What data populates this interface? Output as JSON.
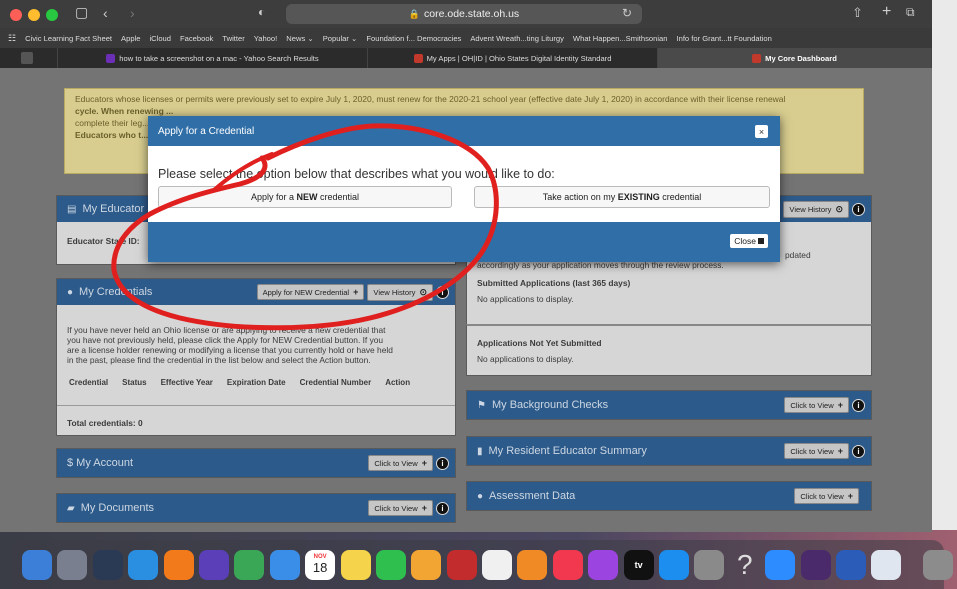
{
  "browser": {
    "url": "core.ode.state.oh.us",
    "bookmarks": [
      "Civic Learning Fact Sheet",
      "Apple",
      "iCloud",
      "Facebook",
      "Twitter",
      "Yahoo!",
      "News ⌄",
      "Popular ⌄",
      "Foundation f... Democracies",
      "Advent Wreath...ting Liturgy",
      "What Happen...Smithsonian",
      "Info for Grant...tt Foundation"
    ],
    "tabs": [
      {
        "label": "how to take a screenshot on a mac - Yahoo Search Results",
        "color": "#6b2fb6"
      },
      {
        "label": "My Apps | OH|ID | Ohio States Digital Identity Standard",
        "color": "#c0392b"
      },
      {
        "label": "My Core Dashboard",
        "color": "#c0392b",
        "active": true
      }
    ]
  },
  "page": {
    "warning_line1": "Educators whose licenses or permits were previously set to expire July 1, 2020, must renew for the 2020-21 school year (effective date July 1, 2020) in accordance with their license renewal",
    "warning_line2": "cycle. When renewing ...",
    "warning_line3": "complete their leg...",
    "warning_line4": "Educators who t...",
    "educator_panel": {
      "title": "My Educator",
      "sid_label": "Educator State ID:"
    },
    "view_history_label": "View History",
    "updated_text": "pdated",
    "review_text": "accordingly as your application moves through the review process.",
    "submitted_title": "Submitted Applications (last 365 days)",
    "submitted_empty": "No applications to display.",
    "notsubmitted_title": "Applications Not Yet Submitted",
    "notsubmitted_empty": "No applications to display.",
    "credentials": {
      "title": "My Credentials",
      "apply_btn": "Apply for NEW Credential",
      "history_btn": "View History",
      "help_line1": "If you have never held an Ohio license or are applying to receive a new credential that",
      "help_line2": "you have not previously held, please click the Apply for NEW Credential button. If you",
      "help_line3": "are a license holder renewing or modifying a license that you currently hold or have held",
      "help_line4": "in the past, please find the credential in the list below and select the Action button.",
      "columns": [
        "Credential",
        "Status",
        "Effective Year",
        "Expiration Date",
        "Credential Number",
        "Action"
      ],
      "total": "Total credentials: 0"
    },
    "account_title": "$ My Account",
    "documents_title": "My Documents",
    "background_title": "My Background Checks",
    "resident_title": "My Resident Educator Summary",
    "assessment_title": "Assessment Data",
    "click_to_view": "Click to View"
  },
  "modal": {
    "title": "Apply for a Credential",
    "close_x": "×",
    "prompt": "Please select the option below that describes what you would like to do:",
    "btn_new_prefix": "Apply for a ",
    "btn_new_bold": "NEW",
    "btn_new_suffix": " credential",
    "btn_existing_prefix": "Take action on my ",
    "btn_existing_bold": "EXISTING",
    "btn_existing_suffix": " credential",
    "close_label": "Close"
  },
  "dock": {
    "apps": [
      "finder-icon",
      "launchpad-icon",
      "mission-control-icon",
      "safari-icon",
      "firefox-icon",
      "notability-icon",
      "chrome-icon",
      "mail-icon",
      "calendar-icon",
      "notes-icon",
      "facetime-icon",
      "pages-icon",
      "photo-booth-icon",
      "photos-icon",
      "books-icon",
      "music-icon",
      "podcasts-icon",
      "tv-icon",
      "app-store-icon",
      "system-preferences-icon",
      "help-icon",
      "zoom-icon",
      "joker-icon",
      "word-icon",
      "preview-icon",
      "trash-icon"
    ],
    "calendar_day": "18",
    "calendar_month": "NOV",
    "tv_label": "tv",
    "help_label": "?"
  },
  "colors": {
    "panel_header": "#2c5a8a",
    "modal_header": "#2f6ea7",
    "scribble": "#e0201e"
  }
}
